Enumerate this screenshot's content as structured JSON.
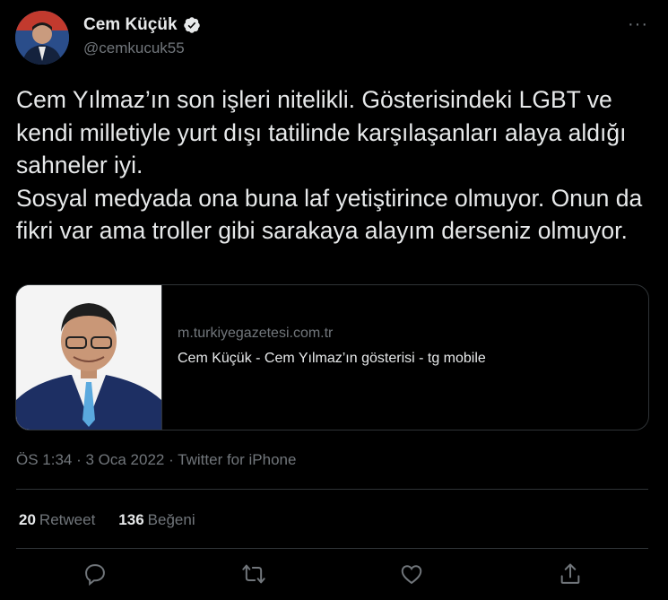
{
  "header": {
    "display_name": "Cem Küçük",
    "handle": "@cemkucuk55",
    "more_label": "···",
    "verified_color": "#e7e9ea"
  },
  "tweet": {
    "text": "Cem Yılmaz’ın son işleri nitelikli. Gösterisindeki LGBT ve kendi milletiyle yurt dışı tatilinde karşılaşanları alaya aldığı sahneler iyi.\nSosyal medyada ona buna laf yetiştirince olmuyor. Onun da fikri var ama troller gibi sarakaya alayım derseniz olmuyor."
  },
  "card": {
    "domain": "m.turkiyegazetesi.com.tr",
    "title": "Cem Küçük - Cem Yılmaz’ın gösterisi - tg mobile"
  },
  "meta": {
    "line": "ÖS 1:34 · 3 Oca 2022 · Twitter for iPhone"
  },
  "stats": {
    "retweet_count": "20",
    "retweet_label": "Retweet",
    "like_count": "136",
    "like_label": "Beğeni"
  },
  "actions": [
    "reply-icon",
    "retweet-icon",
    "like-icon",
    "share-icon"
  ],
  "colors": {
    "background": "#000000",
    "text": "#e7e9ea",
    "secondary": "#71767b",
    "border": "#2f3336"
  }
}
